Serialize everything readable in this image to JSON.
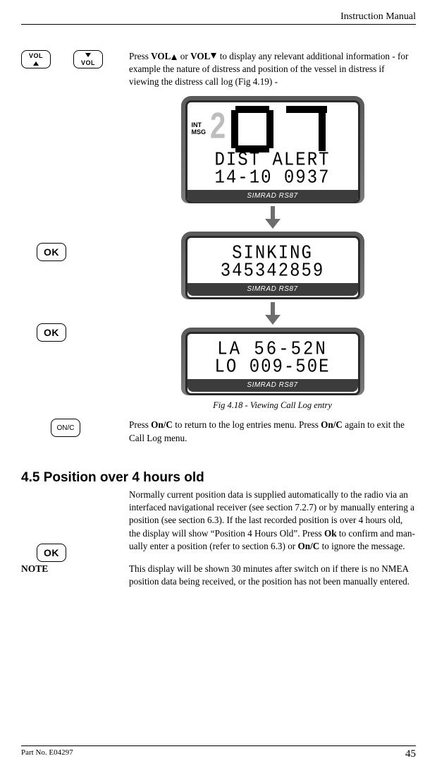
{
  "header": "Instruction Manual",
  "buttons": {
    "vol": "VOL",
    "ok": "OK",
    "onc": "ON/C"
  },
  "intro": {
    "pre1": "Press ",
    "b1": "VOL",
    "mid": " or ",
    "b2": "VOL",
    "post": " to display any relevant additional information - for example the nature of distress and position of the vessel in distress if viewing the distress call log (Fig 4.19) -"
  },
  "lcd": {
    "side1": "INT",
    "side2": "MSG",
    "two": "2",
    "big": "07",
    "screen1_line1": "DIST ALERT",
    "screen1_line2": "14-10 0937",
    "screen2_line1": "SINKING",
    "screen2_line2": "345342859",
    "screen3_line1": "LA 56-52N",
    "screen3_line2": "LO 009-50E",
    "brand": "SIMRAD RS87"
  },
  "caption": "Fig 4.18 - Viewing Call Log entry",
  "onc_para": {
    "p1": "Press ",
    "b1": "On/C",
    "p2": " to return to the log entries menu.  Press ",
    "b2": "On/C",
    "p3": " again to exit the Call Log menu."
  },
  "section": {
    "heading": "4.5  Position over 4 hours old",
    "para_a": "Normally current position data is supplied automatically to the radio via an interfaced navigational receiver (see section 7.2.7) or by manually entering a position (see section 6.3).  If the last recorded position is over 4 hours old, the display will show “Position 4 Hours Old”.  Press ",
    "b1": "Ok",
    "para_b": " to confirm and man-ually enter a position (refer to section 6.3) or ",
    "b2": "On/C",
    "para_c": " to ignore the message."
  },
  "note": {
    "label": "NOTE",
    "text": "This display will be shown 30 minutes after switch on if there is no NMEA position data being received, or the position has not been manually entered."
  },
  "footer": {
    "part": "Part No. E04297",
    "page": "45"
  }
}
